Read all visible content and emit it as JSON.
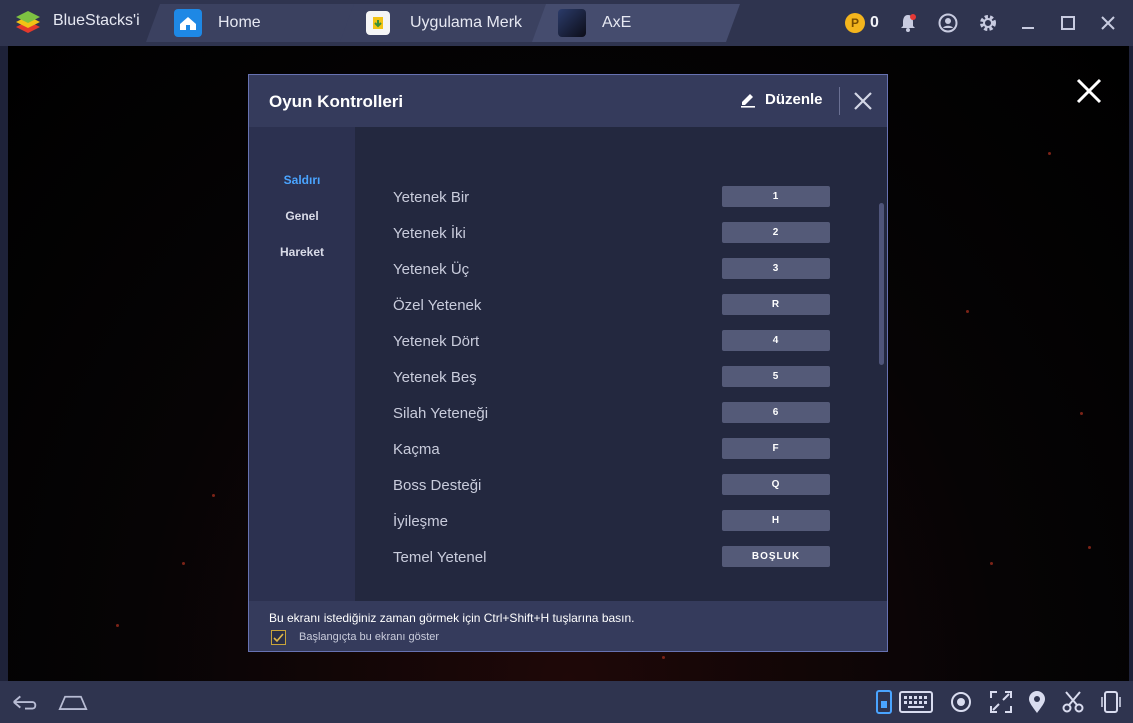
{
  "titlebar": {
    "app_name": "BlueStacks'i",
    "tabs": [
      {
        "label": "Home",
        "icon": "home-icon"
      },
      {
        "label": "Uygulama Merk",
        "icon": "app-center-icon"
      },
      {
        "label": "AxE",
        "icon": "game-thumbnail-icon"
      }
    ],
    "coin_symbol": "P",
    "coin_count": "0",
    "right_icons": [
      "bell-icon",
      "account-icon",
      "gear-icon",
      "minimize-icon",
      "maximize-icon",
      "window-close-icon"
    ]
  },
  "dialog": {
    "title": "Oyun Kontrolleri",
    "edit_label": "Düzenle",
    "sidebar": [
      {
        "label": "Saldırı",
        "active": true
      },
      {
        "label": "Genel",
        "active": false
      },
      {
        "label": "Hareket",
        "active": false
      }
    ],
    "controls": [
      {
        "label": "Yetenek Bir",
        "key": "1"
      },
      {
        "label": "Yetenek İki",
        "key": "2"
      },
      {
        "label": "Yetenek Üç",
        "key": "3"
      },
      {
        "label": "Özel Yetenek",
        "key": "R"
      },
      {
        "label": "Yetenek Dört",
        "key": "4"
      },
      {
        "label": "Yetenek Beş",
        "key": "5"
      },
      {
        "label": "Silah Yeteneği",
        "key": "6"
      },
      {
        "label": "Kaçma",
        "key": "F"
      },
      {
        "label": "Boss Desteği",
        "key": "Q"
      },
      {
        "label": "İyileşme",
        "key": "H"
      },
      {
        "label": "Temel Yetenel",
        "key": "BOŞLUK"
      }
    ],
    "footer": {
      "hint": "Bu ekranı istediğiniz zaman görmek için Ctrl+Shift+H tuşlarına basın.",
      "checkbox_label": "Başlangıçta bu ekranı göster",
      "checkbox_checked": true
    }
  },
  "bottombar": {
    "left_icons": [
      "back-icon",
      "home-nav-icon"
    ],
    "right_icons": [
      "phone-keymap-icon",
      "keyboard-icon",
      "eye-icon",
      "fullscreen-icon",
      "location-pin-icon",
      "scissors-icon",
      "rotate-device-icon"
    ]
  },
  "colors": {
    "accent": "#4aa4ff",
    "coin": "#f4b51d",
    "titlebar": "#2f344f",
    "dialog_bg": "#23283f",
    "key_button": "#545a78"
  }
}
